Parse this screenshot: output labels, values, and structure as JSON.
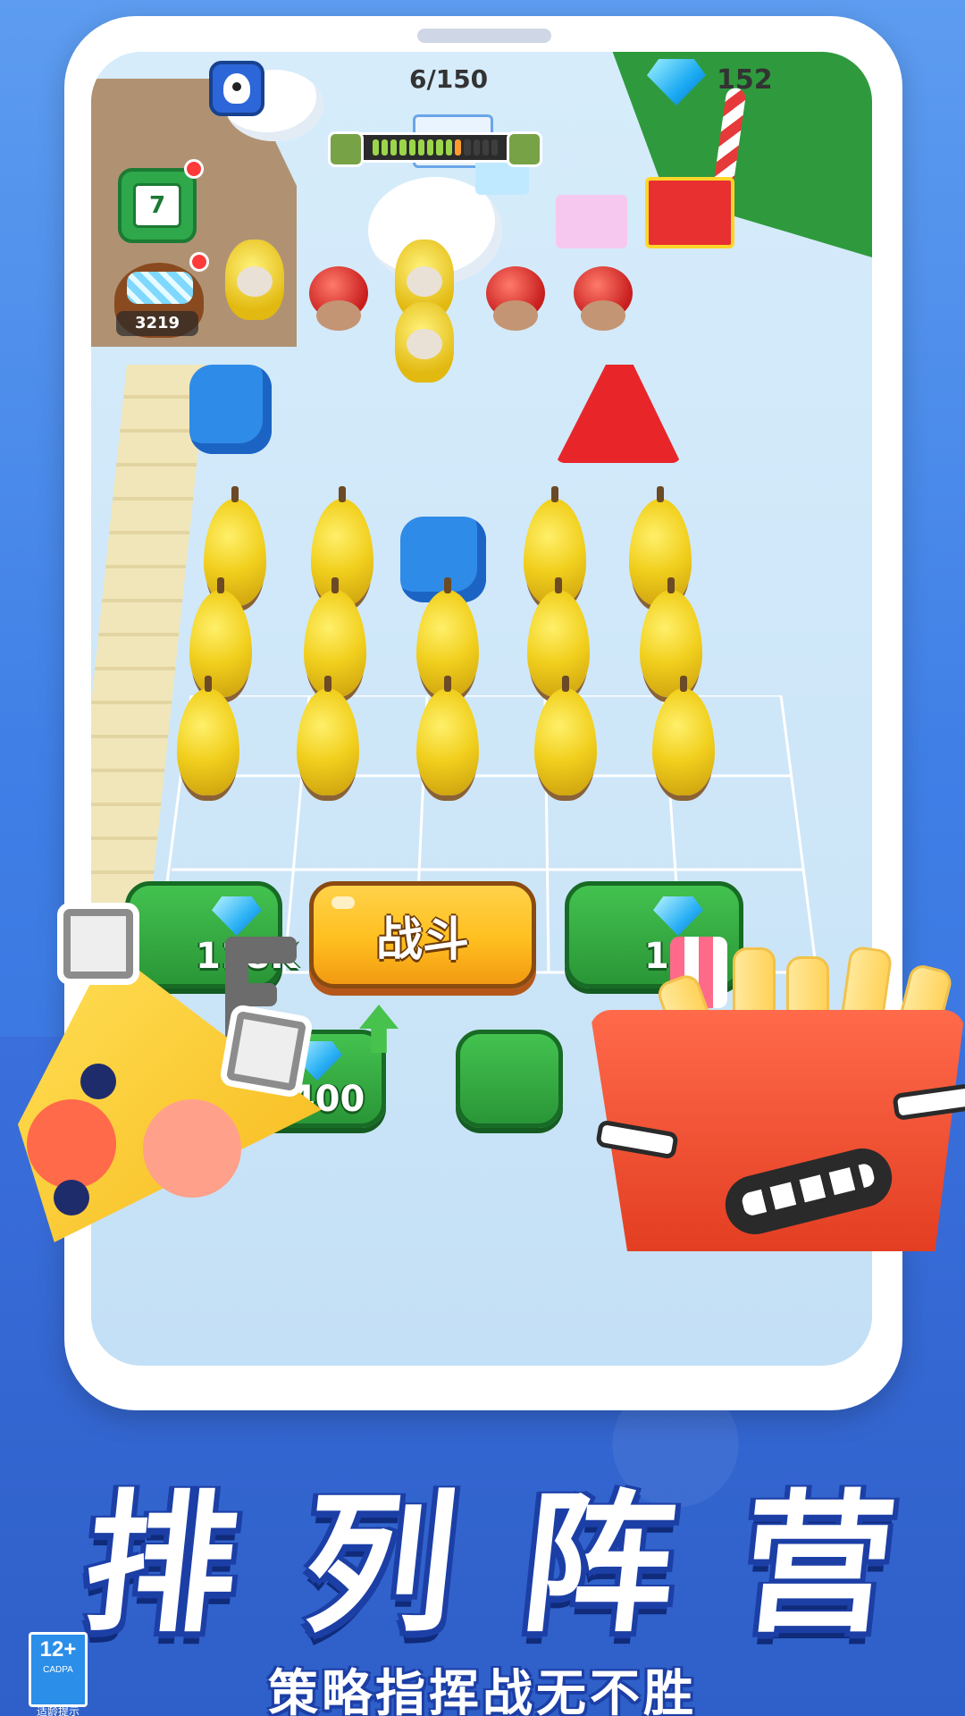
{
  "hud": {
    "wave": "6/150",
    "gems": "152",
    "calendar_day": "7",
    "pouch_count": "3219",
    "progress_filled": 10,
    "progress_total": 14
  },
  "buttons": {
    "fight": "战斗",
    "buy_letter_cost": "118K",
    "upgrade_cost": "1400",
    "buy_cup_cost": "1"
  },
  "promo": {
    "title_chars": [
      "排",
      "列",
      "阵",
      "营"
    ],
    "subtitle": "策略指挥战无不胜",
    "age_rating": "12+",
    "age_org": "CADPA",
    "age_tip": "适龄提示"
  },
  "colors": {
    "background": "#3b7ee8",
    "fight_button": "#ffbf1f",
    "green_button": "#2a9637",
    "title_outline": "#1c3fa6"
  }
}
